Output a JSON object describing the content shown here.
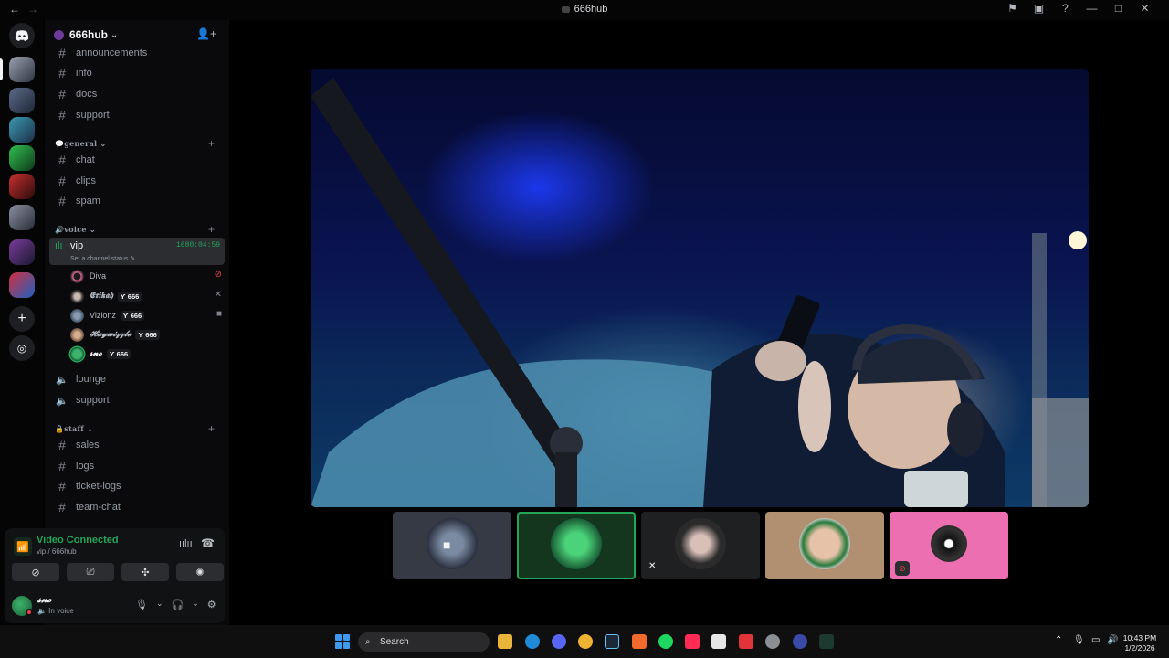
{
  "window": {
    "title": "666hub",
    "nav_back": "←",
    "nav_forward": "→",
    "controls": [
      "⚑",
      "▣",
      "?",
      "—",
      "□",
      "✕"
    ]
  },
  "server": {
    "name": "666hub",
    "chevron": "⌄",
    "invite_icon": "add-member-icon"
  },
  "channels_top": [
    "announcements",
    "info",
    "docs",
    "support"
  ],
  "categories": {
    "general": "💬general ⌄",
    "voice": "🔊voice ⌄",
    "staff": "🔒staff ⌄",
    "plus": "+"
  },
  "general_channels": [
    "chat",
    "clips",
    "spam"
  ],
  "voice_channel": {
    "name": "vip",
    "timer": "1680:04:59",
    "status_placeholder": "Set a channel status ✎"
  },
  "voice_users": [
    {
      "name": "Diva",
      "tag": "",
      "indicator": "⊘"
    },
    {
      "name": "𝕰𝖗𝖎𝖐𝖆𝖍",
      "tag": "Ƴ 666",
      "indicator": "✕"
    },
    {
      "name": "Vizionz",
      "tag": "Ƴ 666",
      "indicator": "■"
    },
    {
      "name": "𝓗𝓪𝔂𝔀𝓲𝔃𝔃𝓵𝓮",
      "tag": "Ƴ 666",
      "indicator": ""
    },
    {
      "name": "𝓼𝓷𝓸",
      "tag": "Ƴ 666",
      "indicator": ""
    }
  ],
  "voice_channels_more": [
    "lounge",
    "support"
  ],
  "staff_channels": [
    "sales",
    "logs",
    "ticket-logs",
    "team-chat"
  ],
  "voice_panel": {
    "status": "Video Connected",
    "location": "vip / 666hub",
    "buttons": [
      "camera-off",
      "screen-share",
      "activities",
      "soundboard"
    ]
  },
  "user": {
    "name": "𝓼𝓷𝓸",
    "status": "🔈 In voice"
  },
  "taskbar": {
    "search_label": "Search",
    "time": "10:43 PM",
    "date": "1/2/2026"
  },
  "colors": {
    "accent_green": "#23a55a",
    "tile_pink": "#eb6fb1",
    "tile_tan": "#b09070"
  }
}
